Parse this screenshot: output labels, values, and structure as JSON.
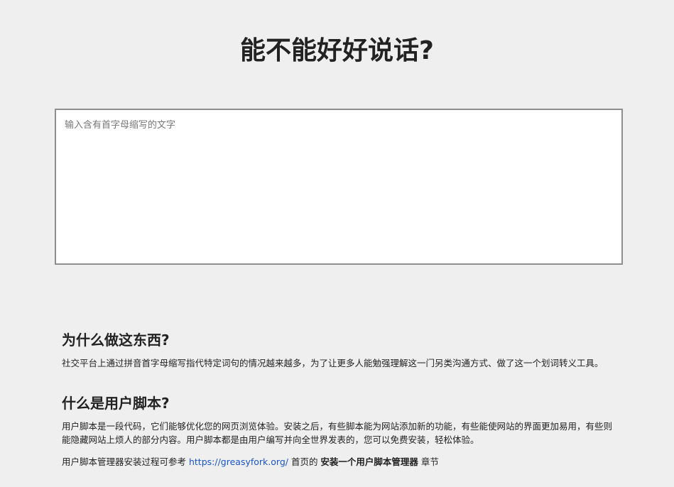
{
  "header": {
    "title": "能不能好好说话?"
  },
  "input": {
    "placeholder": "输入含有首字母缩写的文字",
    "value": ""
  },
  "sections": [
    {
      "heading": "为什么做这东西?",
      "text": "社交平台上通过拼音首字母缩写指代特定词句的情况越来越多，为了让更多人能勉强理解这一门另类沟通方式、做了这一个划词转义工具。"
    },
    {
      "heading": "什么是用户脚本?",
      "text": "用户脚本是一段代码，它们能够优化您的网页浏览体验。安装之后，有些脚本能为网站添加新的功能，有些能使网站的界面更加易用，有些则能隐藏网站上烦人的部分内容。用户脚本都是由用户编写并向全世界发表的，您可以免费安装，轻松体验。",
      "extra": {
        "prefix": "用户脚本管理器安装过程可参考 ",
        "link": "https://greasyfork.org/",
        "middle": " 首页的 ",
        "strong": "安装一个用户脚本管理器",
        "suffix": " 章节"
      }
    }
  ]
}
